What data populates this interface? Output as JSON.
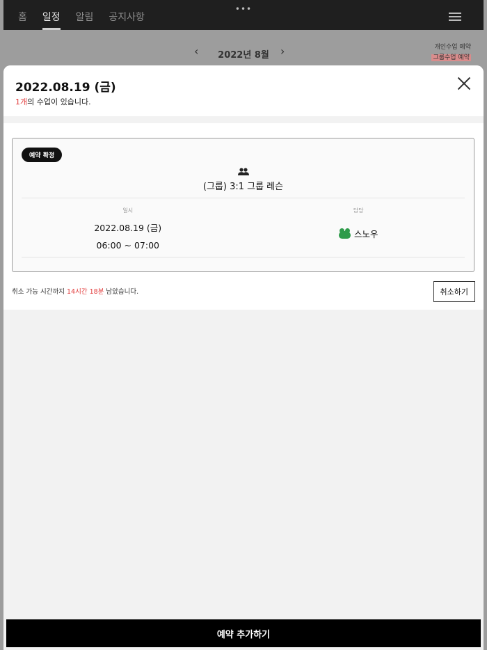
{
  "nav": {
    "tabs": [
      {
        "label": "홈",
        "active": false
      },
      {
        "label": "일정",
        "active": true
      },
      {
        "label": "알림",
        "active": false
      },
      {
        "label": "공지사항",
        "active": false
      }
    ],
    "more_icon": "•••",
    "menu_icon": "hamburger-icon"
  },
  "calendar": {
    "month_label": "2022년 8월",
    "prev_icon": "‹",
    "next_icon": "›",
    "legend": {
      "personal": "개인수업 예약",
      "group": "그룹수업 예약"
    }
  },
  "modal": {
    "date_title": "2022.08.19 (금)",
    "count_red": "1개",
    "count_rest": "의 수업이 있습니다.",
    "card": {
      "status_badge": "예약 확정",
      "lesson_name": "(그룹) 3:1 그룹 레슨",
      "datetime_label": "일시",
      "date": "2022.08.19 (금)",
      "time": "06:00 ~ 07:00",
      "teacher_label": "담당",
      "teacher_name": "스노우"
    },
    "cancel_prefix": "취소 가능 시간까지 ",
    "cancel_remaining": "14시간 18분",
    "cancel_suffix": " 남았습니다.",
    "cancel_button": "취소하기",
    "add_button": "예약 추가하기"
  },
  "colors": {
    "accent_red": "#e23b3b",
    "badge_bg": "#111111",
    "teacher_icon": "#2e9b4a"
  }
}
